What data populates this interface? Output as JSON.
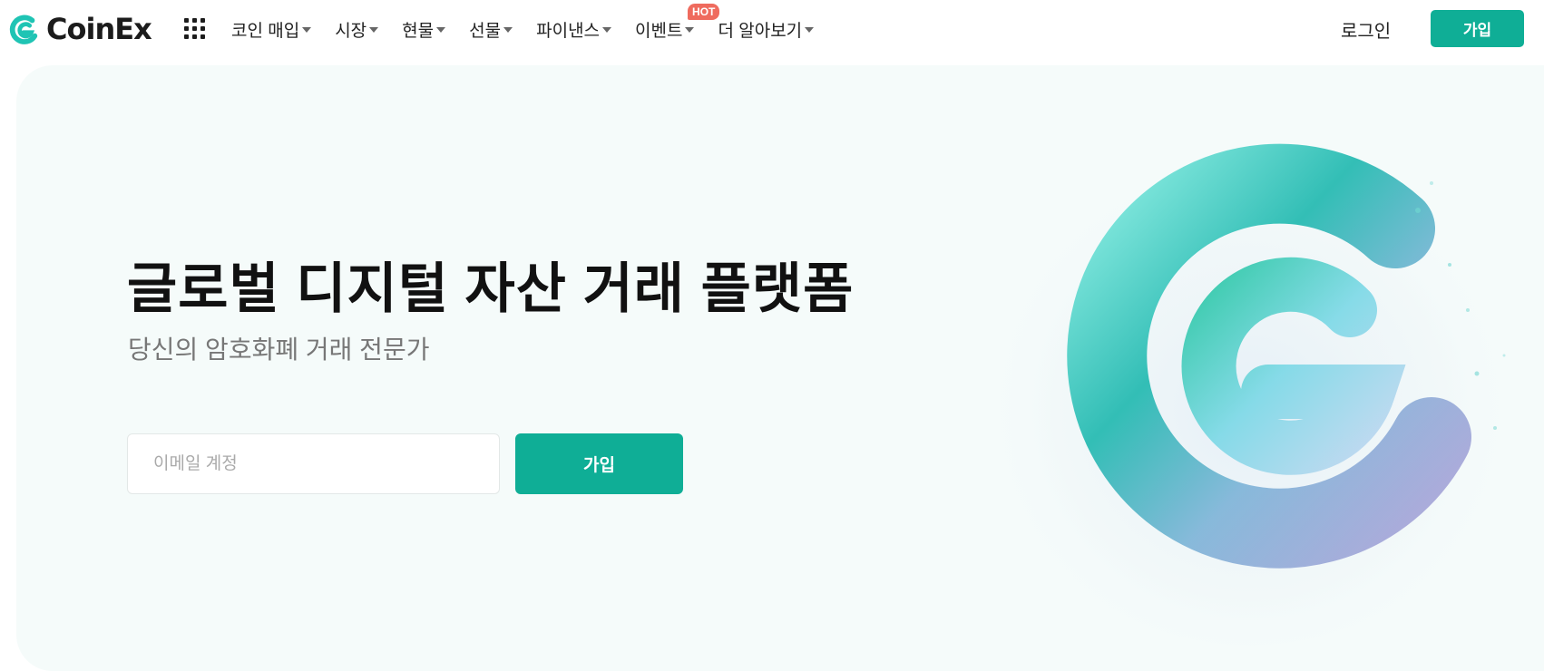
{
  "header": {
    "logo_text": "CoinEx",
    "nav": [
      {
        "label": "코인 매입"
      },
      {
        "label": "시장"
      },
      {
        "label": "현물"
      },
      {
        "label": "선물"
      },
      {
        "label": "파이낸스"
      },
      {
        "label": "이벤트",
        "badge": "HOT"
      },
      {
        "label": "더 알아보기"
      }
    ],
    "login_label": "로그인",
    "signup_label": "가입"
  },
  "hero": {
    "title": "글로벌 디지털 자산 거래 플랫폼",
    "subtitle": "당신의 암호화폐 거래 전문가",
    "email_placeholder": "이메일 계정",
    "signup_label": "가입"
  },
  "colors": {
    "accent": "#0fae96",
    "hot_badge": "#ef6b5e",
    "hero_bg": "#f5fbfa",
    "logo_mark": "#1fc4b4"
  },
  "icons": {
    "logo": "coinex-logo-icon",
    "apps": "apps-grid-icon",
    "dropdown": "caret-down-icon"
  }
}
